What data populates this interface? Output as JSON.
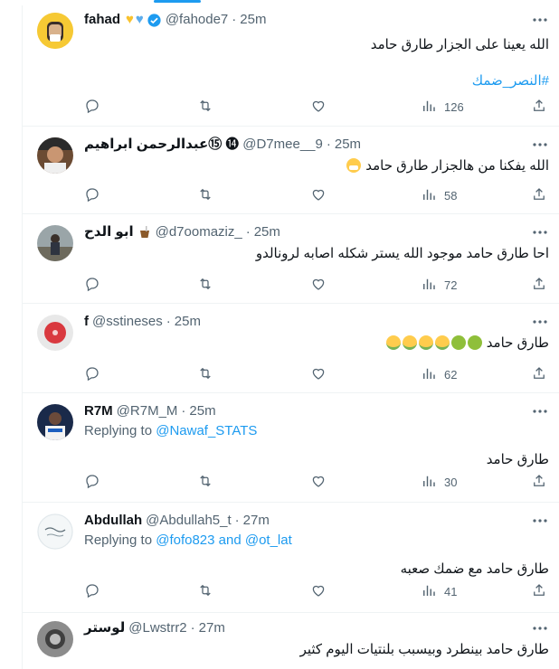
{
  "tweets": [
    {
      "name": "fahad",
      "name_emojis": [
        "yellow-heart",
        "blue-heart"
      ],
      "verified": true,
      "handle": "@fahode7",
      "time": "25m",
      "replying_to": "",
      "text": "الله يعينا على الجزار طارق حامد",
      "hashtag": "#النصر_ضمك",
      "views": "126"
    },
    {
      "name": "عبدالرحمن ابراهيم⑮",
      "name_prefix": "⓮",
      "handle": "@D7mee__9",
      "time": "25m",
      "replying_to": "",
      "text": "الله يفكنا من هالجزار طارق حامد",
      "text_emoji": "mask",
      "views": "58"
    },
    {
      "name": "ابو الدح",
      "name_emoji": "mate",
      "handle": "@d7oomaziz_",
      "time": "25m",
      "replying_to": "",
      "text": "احا طارق حامد موجود الله يستر شكله اصابه لرونالدو",
      "views": "72"
    },
    {
      "name": "f",
      "handle": "@sstineses",
      "time": "25m",
      "replying_to": "",
      "text": "طارق حامد",
      "text_emojis": [
        "nauseated",
        "nauseated",
        "vomit",
        "vomit",
        "vomit",
        "vomit"
      ],
      "views": "62"
    },
    {
      "name": "R7M",
      "handle": "@R7M_M",
      "time": "25m",
      "replying_label": "Replying to",
      "replying_to": "@Nawaf_STATS",
      "text": "طارق حامد",
      "views": "30"
    },
    {
      "name": "Abdullah",
      "handle": "@Abdullah5_t",
      "time": "27m",
      "replying_label": "Replying to",
      "replying_to": "@fofo823 and @ot_lat",
      "text": "طارق حامد مع ضمك صعبه",
      "views": "41"
    },
    {
      "name": "لوستر",
      "handle": "@Lwstrr2",
      "time": "27m",
      "replying_to": "",
      "text": "طارق حامد بينطرد وبيسبب بلنتيات اليوم كثير",
      "views": ""
    }
  ],
  "colors": {
    "accent": "#1d9bf0",
    "secondary": "#536471",
    "border": "#eff3f4"
  },
  "icons": [
    "reply-icon",
    "retweet-icon",
    "like-icon",
    "views-icon",
    "share-icon",
    "more-icon",
    "verified-icon"
  ]
}
